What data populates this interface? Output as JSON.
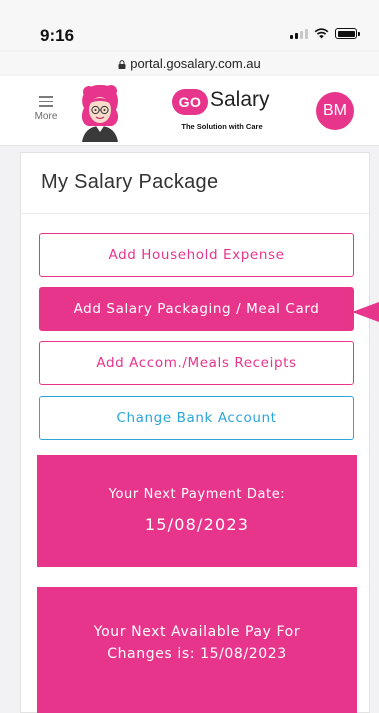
{
  "status_bar": {
    "time": "9:16"
  },
  "browser": {
    "url": "portal.gosalary.com.au"
  },
  "header": {
    "menu_label": "More",
    "logo_go": "GO",
    "logo_word": "Salary",
    "logo_tagline": "The Solution with Care",
    "user_initials": "BM"
  },
  "card": {
    "title": "My Salary Package",
    "buttons": {
      "household": "Add Household Expense",
      "salary_packaging": "Add Salary Packaging / Meal Card",
      "accom_meals": "Add Accom./Meals Receipts",
      "bank_account": "Change Bank Account"
    },
    "next_payment": {
      "label": "Your Next Payment Date:",
      "value": "15/08/2023"
    },
    "next_pay_changes": {
      "line1": "Your Next Available Pay For",
      "line2": "Changes is: 15/08/2023"
    }
  },
  "colors": {
    "brand_pink": "#e8358c",
    "accent_blue": "#2aa6d8"
  }
}
